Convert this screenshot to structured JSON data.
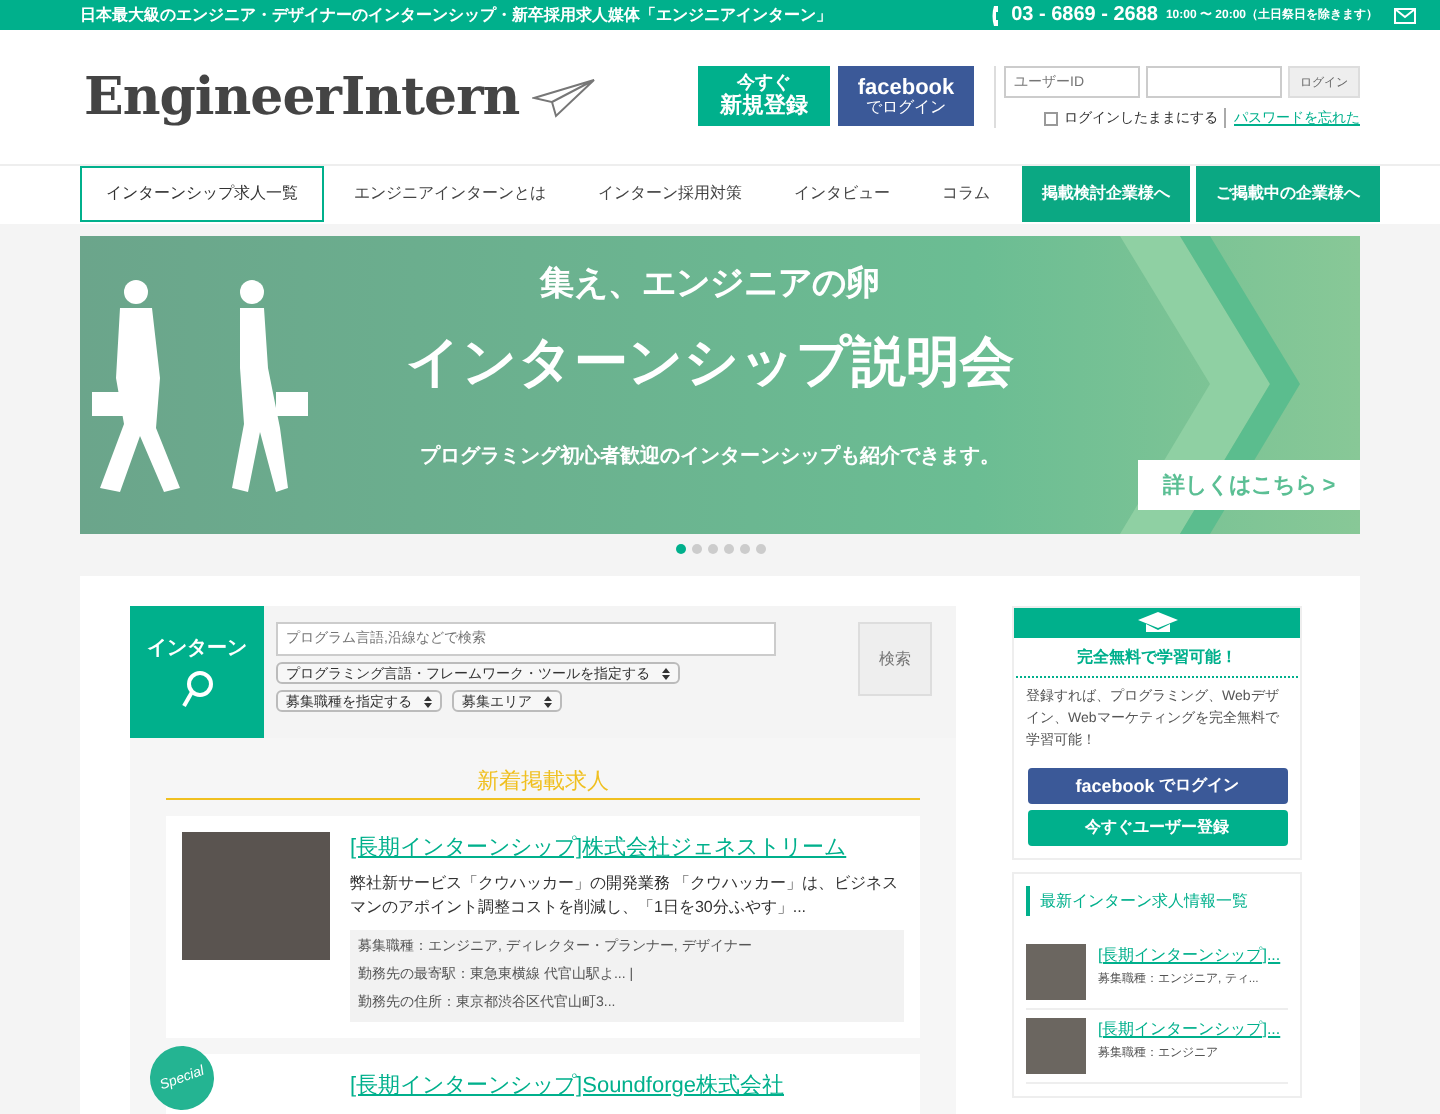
{
  "top_bar": {
    "tagline": "日本最大級のエンジニア・デザイナーのインターンシップ・新卒採用求人媒体「エンジニアインターン」",
    "phone": "03 - 6869 - 2688",
    "hours": "10:00 〜 20:00（土日祭日を除きます）"
  },
  "header": {
    "logo": "EngineerIntern",
    "register_button": {
      "line1": "今すぐ",
      "line2": "新規登録"
    },
    "facebook_button": {
      "brand": "facebook",
      "label": "でログイン"
    },
    "user_id": {
      "placeholder": "ユーザーID"
    },
    "login_button": "ログイン",
    "remember": {
      "label": "ログインしたままにする",
      "checked": false
    },
    "forgot_link": "パスワードを忘れた"
  },
  "nav": [
    {
      "label": "インターンシップ求人一覧",
      "kind": "tab",
      "selected": true
    },
    {
      "label": "エンジニアインターンとは",
      "kind": "tab",
      "selected": false
    },
    {
      "label": "インターン採用対策",
      "kind": "tab",
      "selected": false
    },
    {
      "label": "インタビュー",
      "kind": "tab",
      "selected": false
    },
    {
      "label": "コラム",
      "kind": "tab",
      "selected": false
    },
    {
      "label": "掲載検討企業様へ",
      "kind": "action"
    },
    {
      "label": "ご掲載中の企業様へ",
      "kind": "action"
    }
  ],
  "banner": {
    "kicker": "集え、エンジニアの卵",
    "title": "インターンシップ説明会",
    "subtitle": "プログラミング初心者歓迎のインターンシップも紹介できます。",
    "cta": "詳しくはこちら >"
  },
  "carousel_dots": [
    {
      "selected": true
    },
    {
      "selected": false
    },
    {
      "selected": false
    },
    {
      "selected": false
    },
    {
      "selected": false
    },
    {
      "selected": false
    }
  ],
  "search": {
    "label": "インターン",
    "keyword": {
      "placeholder": "プログラム言語,沿線などで検索"
    },
    "selects": [
      "プログラミング言語・フレームワーク・ツールを指定する",
      "募集職種を指定する",
      "募集エリア"
    ],
    "button": "検索"
  },
  "new_listings": {
    "heading": "新着掲載求人",
    "items": [
      {
        "title": "[長期インターンシップ]株式会社ジェネストリーム",
        "special": false,
        "description": "弊社新サービス「クウハッカー」の開発業務 「クウハッカー」は、ビジネスマンのアポイント調整コストを削減し、「1日を30分ふやす」...",
        "details": [
          "募集職種：エンジニア, ディレクター・プランナー, デザイナー",
          "勤務先の最寄駅：東急東横線 代官山駅よ... |",
          "勤務先の住所：東京都渋谷区代官山町3..."
        ]
      },
      {
        "title": "[長期インターンシップ]Soundforge株式会社",
        "special": true,
        "special_label": "Special"
      }
    ]
  },
  "sidebar": {
    "promo": {
      "heading": "完全無料で学習可能！",
      "text": "登録すれば、プログラミング、Webデザイン、Webマーケティングを完全無料で学習可能！",
      "facebook_button": {
        "brand": "facebook",
        "label": "でログイン"
      },
      "register_button": "今すぐユーザー登録"
    },
    "latest": {
      "heading": "最新インターン求人情報一覧",
      "items": [
        {
          "title": "[長期インターンシップ]...",
          "role": "募集職種：エンジニア, ティ..."
        },
        {
          "title": "[長期インターンシップ]...",
          "role": "募集職種：エンジニア"
        }
      ]
    }
  }
}
